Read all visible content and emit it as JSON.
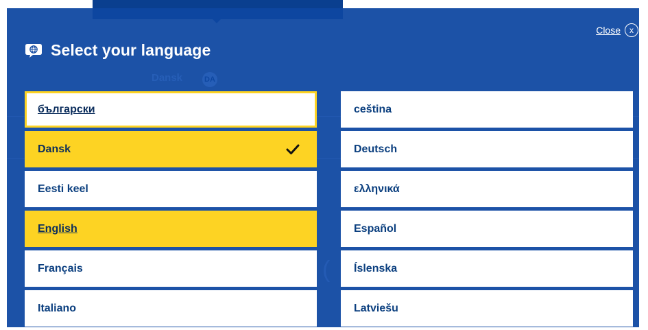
{
  "dialog": {
    "title": "Select your language",
    "close_label": "Close",
    "close_glyph": "x"
  },
  "background": {
    "current_language": "Dansk",
    "current_code": "DA"
  },
  "languages_left": [
    {
      "label": "български",
      "state": "focused"
    },
    {
      "label": "Dansk",
      "state": "selected"
    },
    {
      "label": "Eesti keel",
      "state": "normal"
    },
    {
      "label": "English",
      "state": "selected-underlined"
    },
    {
      "label": "Français",
      "state": "normal"
    },
    {
      "label": "Italiano",
      "state": "normal"
    }
  ],
  "languages_right": [
    {
      "label": "ceština",
      "state": "normal"
    },
    {
      "label": "Deutsch",
      "state": "normal"
    },
    {
      "label": "ελληνικά",
      "state": "normal"
    },
    {
      "label": "Español",
      "state": "normal"
    },
    {
      "label": "Íslenska",
      "state": "normal"
    },
    {
      "label": "Latviešu",
      "state": "normal"
    }
  ],
  "icons": {
    "globe": "globe-chat-icon",
    "check": "checkmark-icon",
    "close": "close-circle-icon"
  },
  "colors": {
    "overlay": "#0e47a1",
    "selected": "#fdd323",
    "text": "#0b3f7f"
  }
}
